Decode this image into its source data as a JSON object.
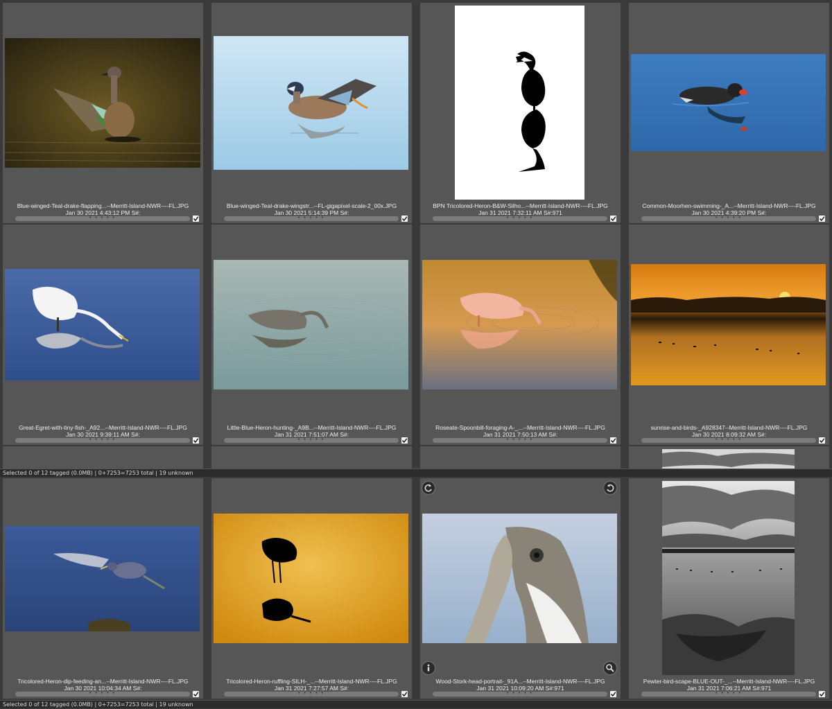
{
  "status_text": "Selected 0 of 12 tagged (0.0MB) | 0+7253=7253 total | 19 unknown",
  "photos": [
    {
      "caption_name": "Blue-winged-Teal-drake-flapping...--Merritt-Island-NWR----FL.JPG",
      "caption_date": "Jan 30 2021 4:43:12 PM S#:",
      "rating_dots": "• • • • •",
      "image_subject": "blue-winged teal drake flapping wings on dark water"
    },
    {
      "caption_name": "Blue-winged-Teal-drake-wingstr...--FL-gigapixel-scale-2_00x.JPG",
      "caption_date": "Jan 30 2021 5:14:39 PM S#:",
      "rating_dots": "• • • • •",
      "image_subject": "blue-winged teal drake wing stretch on pale blue water"
    },
    {
      "caption_name": "BPN Tricolored-Heron-B&W-Silho...--Merritt-Island-NWR----FL.JPG",
      "caption_date": "Jan 31 2021 7:32:11 AM S#:971",
      "rating_dots": "• • • • •",
      "image_subject": "tricolored heron black and white silhouette with reflection"
    },
    {
      "caption_name": "Common-Moorhen-swimming-_A...--Merritt-Island-NWR----FL.JPG",
      "caption_date": "Jan 30 2021 4:39:20 PM S#:",
      "rating_dots": "• • • • •",
      "image_subject": "common moorhen swimming on blue water"
    },
    {
      "caption_name": "Great-Egret-with-tiny-fish-_A92...--Merritt-Island-NWR----FL.JPG",
      "caption_date": "Jan 30 2021 9:39:11 AM S#:",
      "rating_dots": "• • • • •",
      "image_subject": "great egret with tiny fish and reflection"
    },
    {
      "caption_name": "Little-Blue-Heron-hunting-_A9B...--Merritt-Island-NWR----FL.JPG",
      "caption_date": "Jan 31 2021 7:51:07 AM S#:",
      "rating_dots": "• • • • •",
      "image_subject": "little blue heron hunting in rippled water"
    },
    {
      "caption_name": "Roseate-Spoonbill-foraging-A-_...--Merritt-Island-NWR----FL.JPG",
      "caption_date": "Jan 31 2021 7:50:13 AM S#:",
      "rating_dots": "• • • • •",
      "image_subject": "roseate spoonbill foraging in golden water"
    },
    {
      "caption_name": "sunrise-and-birds-_A928347--Merritt-Island-NWR----FL.JPG",
      "caption_date": "Jan 30 2021 8:09:32 AM S#:",
      "rating_dots": "• • • • •",
      "image_subject": "orange sunrise over marsh with birds"
    },
    {
      "caption_name": "Tricolored-Heron-dip-feeding-an...--Merritt-Island-NWR----FL.JPG",
      "caption_date": "Jan 30 2021 10:04:34 AM S#:",
      "rating_dots": "• • • • •",
      "image_subject": "tricolored heron dip feeding with spread wings"
    },
    {
      "caption_name": "Tricolored-Heron-ruffling-SILH-_...--Merritt-Island-NWR----FL.JPG",
      "caption_date": "Jan 31 2021 7:27:57 AM S#:",
      "rating_dots": "• • • • •",
      "image_subject": "tricolored heron silhouette on golden water"
    },
    {
      "caption_name": "Wood-Stork-head-portrait-_91A...--Merritt-Island-NWR----FL.JPG",
      "caption_date": "Jan 31 2021 10:09:20 AM S#:971",
      "rating_dots": "• • • • •",
      "image_subject": "wood stork head portrait"
    },
    {
      "caption_name": "Pewter-bird-scape-BLUE-OUT-_...--Merritt-Island-NWR----FL.JPG",
      "caption_date": "Jan 31 2021 7:06:21 AM S#:971",
      "rating_dots": "• • • • •",
      "image_subject": "pewter sky birdscape with cloud reflection"
    }
  ],
  "icons": {
    "tagged_check": "checkmark-icon",
    "rotate_left": "rotate-left-icon",
    "rotate_right": "rotate-right-icon",
    "info": "info-icon",
    "zoom": "magnifier-icon"
  },
  "colors": {
    "background": "#3a3a3a",
    "cell": "#565656",
    "statusbar": "#2c2c2c"
  }
}
